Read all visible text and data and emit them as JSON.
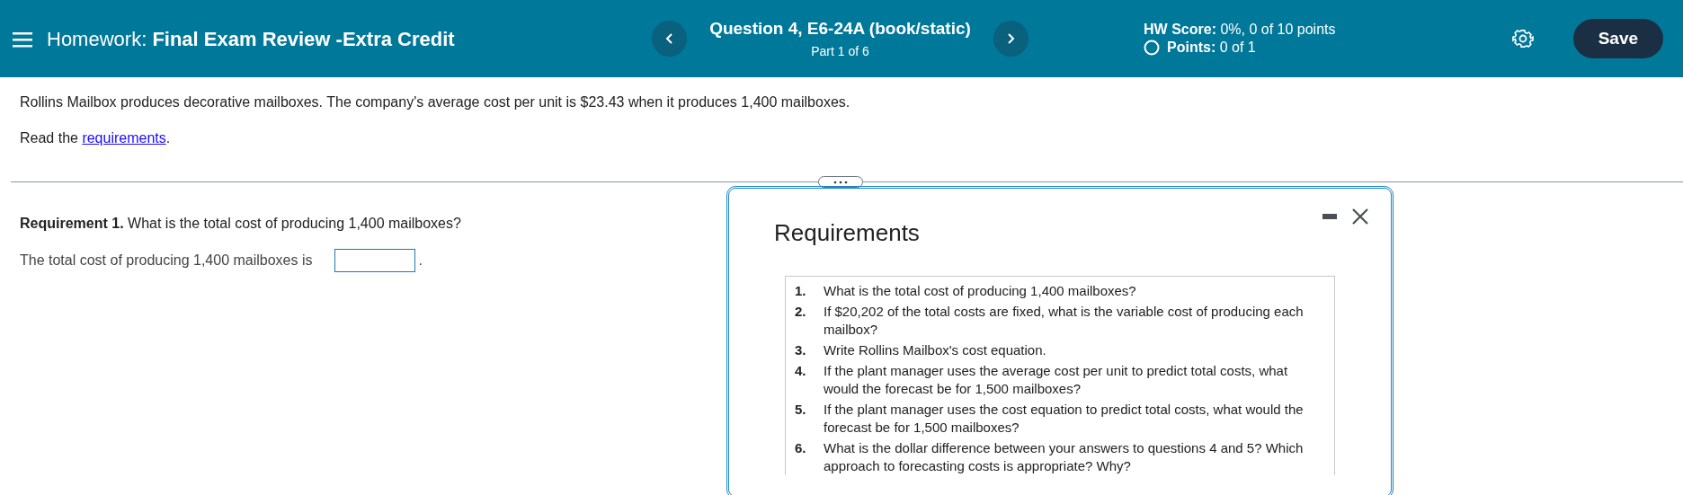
{
  "header": {
    "title_prefix": "Homework:",
    "title": "Final Exam Review -Extra Credit",
    "question": "Question 4, E6-24A (book/static)",
    "part": "Part 1 of 6",
    "hw_score_label": "HW Score:",
    "hw_score": "0%, 0 of 10 points",
    "points_label": "Points:",
    "points": "0 of 1",
    "save": "Save"
  },
  "intro": "Rollins Mailbox produces decorative mailboxes. The company's average cost per unit is $23.43 when it produces 1,400 mailboxes.",
  "read": {
    "prefix": "Read the",
    "link": "requirements",
    "suffix": "."
  },
  "requirement": "**Requirement 1.** What is the total cost of producing 1,400 mailboxes?",
  "answer": {
    "prefix": "The total cost of producing 1,400 mailboxes is",
    "suffix": "."
  },
  "popup": {
    "title": "Requirements",
    "items": [
      {
        "number": "1.",
        "text": "What is the total cost of producing 1,400 mailboxes?"
      },
      {
        "number": "2.",
        "text": "If $20,202 of the total costs are fixed, what is the variable cost of producing each mailbox?"
      },
      {
        "number": "3.",
        "text": "Write Rollins Mailbox's cost equation."
      },
      {
        "number": "4.",
        "text": "If the plant manager uses the average cost per unit to predict total costs, what would the forecast be for 1,500 mailboxes?"
      },
      {
        "number": "5.",
        "text": "If the plant manager uses the cost equation to predict total costs, what would the forecast be for 1,500 mailboxes?"
      },
      {
        "number": "6.",
        "text": "What is the dollar difference between your answers to questions 4 and 5? Which approach to forecasting costs is appropriate? Why?"
      }
    ]
  }
}
